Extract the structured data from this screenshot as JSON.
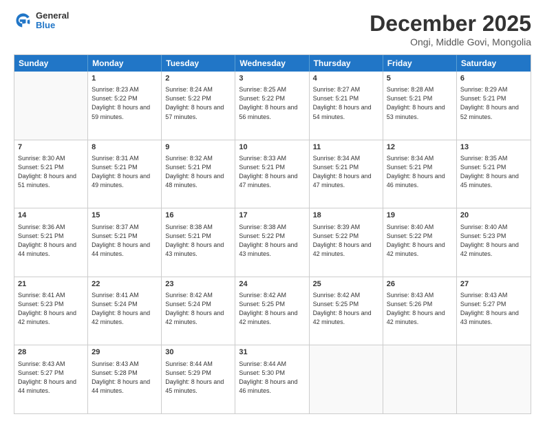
{
  "header": {
    "logo": {
      "general": "General",
      "blue": "Blue"
    },
    "title": "December 2025",
    "subtitle": "Ongi, Middle Govi, Mongolia"
  },
  "calendar": {
    "days": [
      "Sunday",
      "Monday",
      "Tuesday",
      "Wednesday",
      "Thursday",
      "Friday",
      "Saturday"
    ],
    "weeks": [
      [
        {
          "day": "",
          "sunrise": "",
          "sunset": "",
          "daylight": ""
        },
        {
          "day": "1",
          "sunrise": "Sunrise: 8:23 AM",
          "sunset": "Sunset: 5:22 PM",
          "daylight": "Daylight: 8 hours and 59 minutes."
        },
        {
          "day": "2",
          "sunrise": "Sunrise: 8:24 AM",
          "sunset": "Sunset: 5:22 PM",
          "daylight": "Daylight: 8 hours and 57 minutes."
        },
        {
          "day": "3",
          "sunrise": "Sunrise: 8:25 AM",
          "sunset": "Sunset: 5:22 PM",
          "daylight": "Daylight: 8 hours and 56 minutes."
        },
        {
          "day": "4",
          "sunrise": "Sunrise: 8:27 AM",
          "sunset": "Sunset: 5:21 PM",
          "daylight": "Daylight: 8 hours and 54 minutes."
        },
        {
          "day": "5",
          "sunrise": "Sunrise: 8:28 AM",
          "sunset": "Sunset: 5:21 PM",
          "daylight": "Daylight: 8 hours and 53 minutes."
        },
        {
          "day": "6",
          "sunrise": "Sunrise: 8:29 AM",
          "sunset": "Sunset: 5:21 PM",
          "daylight": "Daylight: 8 hours and 52 minutes."
        }
      ],
      [
        {
          "day": "7",
          "sunrise": "Sunrise: 8:30 AM",
          "sunset": "Sunset: 5:21 PM",
          "daylight": "Daylight: 8 hours and 51 minutes."
        },
        {
          "day": "8",
          "sunrise": "Sunrise: 8:31 AM",
          "sunset": "Sunset: 5:21 PM",
          "daylight": "Daylight: 8 hours and 49 minutes."
        },
        {
          "day": "9",
          "sunrise": "Sunrise: 8:32 AM",
          "sunset": "Sunset: 5:21 PM",
          "daylight": "Daylight: 8 hours and 48 minutes."
        },
        {
          "day": "10",
          "sunrise": "Sunrise: 8:33 AM",
          "sunset": "Sunset: 5:21 PM",
          "daylight": "Daylight: 8 hours and 47 minutes."
        },
        {
          "day": "11",
          "sunrise": "Sunrise: 8:34 AM",
          "sunset": "Sunset: 5:21 PM",
          "daylight": "Daylight: 8 hours and 47 minutes."
        },
        {
          "day": "12",
          "sunrise": "Sunrise: 8:34 AM",
          "sunset": "Sunset: 5:21 PM",
          "daylight": "Daylight: 8 hours and 46 minutes."
        },
        {
          "day": "13",
          "sunrise": "Sunrise: 8:35 AM",
          "sunset": "Sunset: 5:21 PM",
          "daylight": "Daylight: 8 hours and 45 minutes."
        }
      ],
      [
        {
          "day": "14",
          "sunrise": "Sunrise: 8:36 AM",
          "sunset": "Sunset: 5:21 PM",
          "daylight": "Daylight: 8 hours and 44 minutes."
        },
        {
          "day": "15",
          "sunrise": "Sunrise: 8:37 AM",
          "sunset": "Sunset: 5:21 PM",
          "daylight": "Daylight: 8 hours and 44 minutes."
        },
        {
          "day": "16",
          "sunrise": "Sunrise: 8:38 AM",
          "sunset": "Sunset: 5:21 PM",
          "daylight": "Daylight: 8 hours and 43 minutes."
        },
        {
          "day": "17",
          "sunrise": "Sunrise: 8:38 AM",
          "sunset": "Sunset: 5:22 PM",
          "daylight": "Daylight: 8 hours and 43 minutes."
        },
        {
          "day": "18",
          "sunrise": "Sunrise: 8:39 AM",
          "sunset": "Sunset: 5:22 PM",
          "daylight": "Daylight: 8 hours and 42 minutes."
        },
        {
          "day": "19",
          "sunrise": "Sunrise: 8:40 AM",
          "sunset": "Sunset: 5:22 PM",
          "daylight": "Daylight: 8 hours and 42 minutes."
        },
        {
          "day": "20",
          "sunrise": "Sunrise: 8:40 AM",
          "sunset": "Sunset: 5:23 PM",
          "daylight": "Daylight: 8 hours and 42 minutes."
        }
      ],
      [
        {
          "day": "21",
          "sunrise": "Sunrise: 8:41 AM",
          "sunset": "Sunset: 5:23 PM",
          "daylight": "Daylight: 8 hours and 42 minutes."
        },
        {
          "day": "22",
          "sunrise": "Sunrise: 8:41 AM",
          "sunset": "Sunset: 5:24 PM",
          "daylight": "Daylight: 8 hours and 42 minutes."
        },
        {
          "day": "23",
          "sunrise": "Sunrise: 8:42 AM",
          "sunset": "Sunset: 5:24 PM",
          "daylight": "Daylight: 8 hours and 42 minutes."
        },
        {
          "day": "24",
          "sunrise": "Sunrise: 8:42 AM",
          "sunset": "Sunset: 5:25 PM",
          "daylight": "Daylight: 8 hours and 42 minutes."
        },
        {
          "day": "25",
          "sunrise": "Sunrise: 8:42 AM",
          "sunset": "Sunset: 5:25 PM",
          "daylight": "Daylight: 8 hours and 42 minutes."
        },
        {
          "day": "26",
          "sunrise": "Sunrise: 8:43 AM",
          "sunset": "Sunset: 5:26 PM",
          "daylight": "Daylight: 8 hours and 42 minutes."
        },
        {
          "day": "27",
          "sunrise": "Sunrise: 8:43 AM",
          "sunset": "Sunset: 5:27 PM",
          "daylight": "Daylight: 8 hours and 43 minutes."
        }
      ],
      [
        {
          "day": "28",
          "sunrise": "Sunrise: 8:43 AM",
          "sunset": "Sunset: 5:27 PM",
          "daylight": "Daylight: 8 hours and 44 minutes."
        },
        {
          "day": "29",
          "sunrise": "Sunrise: 8:43 AM",
          "sunset": "Sunset: 5:28 PM",
          "daylight": "Daylight: 8 hours and 44 minutes."
        },
        {
          "day": "30",
          "sunrise": "Sunrise: 8:44 AM",
          "sunset": "Sunset: 5:29 PM",
          "daylight": "Daylight: 8 hours and 45 minutes."
        },
        {
          "day": "31",
          "sunrise": "Sunrise: 8:44 AM",
          "sunset": "Sunset: 5:30 PM",
          "daylight": "Daylight: 8 hours and 46 minutes."
        },
        {
          "day": "",
          "sunrise": "",
          "sunset": "",
          "daylight": ""
        },
        {
          "day": "",
          "sunrise": "",
          "sunset": "",
          "daylight": ""
        },
        {
          "day": "",
          "sunrise": "",
          "sunset": "",
          "daylight": ""
        }
      ]
    ]
  }
}
